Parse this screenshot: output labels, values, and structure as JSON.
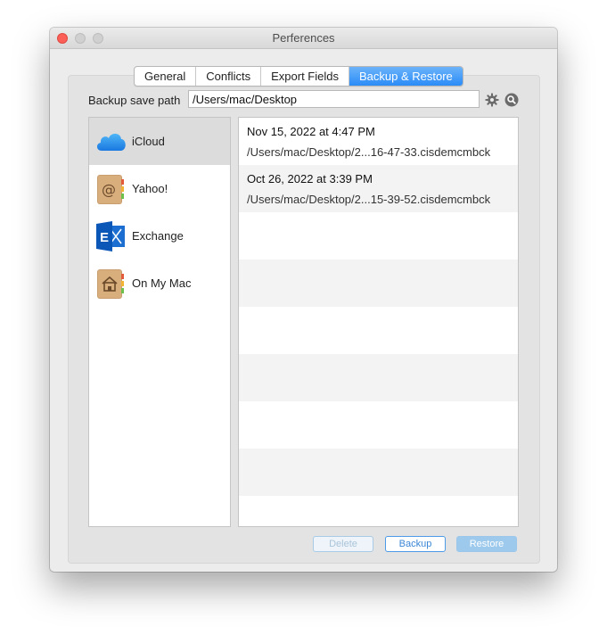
{
  "window": {
    "title": "Perferences"
  },
  "tabs": [
    "General",
    "Conflicts",
    "Export Fields",
    "Backup & Restore"
  ],
  "active_tab": "Backup & Restore",
  "backup": {
    "path_label": "Backup save path",
    "path_value": "/Users/mac/Desktop"
  },
  "accounts": [
    {
      "label": "iCloud",
      "icon": "icloud-icon",
      "selected": true
    },
    {
      "label": "Yahoo!",
      "icon": "yahoo-contacts-icon",
      "selected": false
    },
    {
      "label": "Exchange",
      "icon": "exchange-icon",
      "selected": false
    },
    {
      "label": "On My Mac",
      "icon": "on-my-mac-icon",
      "selected": false
    }
  ],
  "backups": [
    {
      "date": "Nov 15, 2022 at 4:47 PM",
      "path": "/Users/mac/Desktop/2...16-47-33.cisdemcmbck"
    },
    {
      "date": "Oct 26, 2022 at 3:39 PM",
      "path": "/Users/mac/Desktop/2...15-39-52.cisdemcmbck"
    }
  ],
  "buttons": {
    "delete": "Delete",
    "backup": "Backup",
    "restore": "Restore"
  },
  "colors": {
    "accent": "#2a8cf7",
    "selected_row": "#dcdcdc"
  }
}
